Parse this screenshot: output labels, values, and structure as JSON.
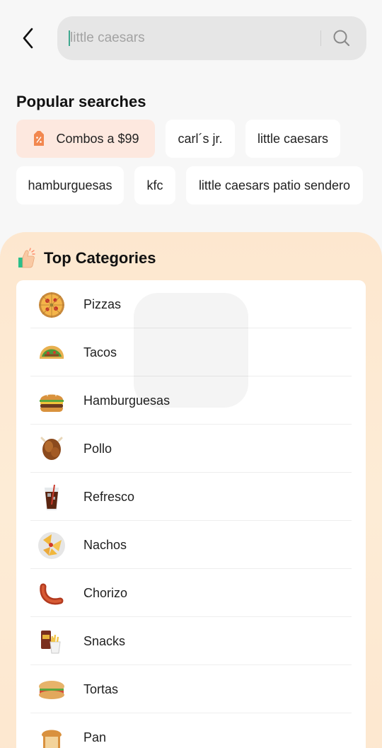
{
  "search": {
    "placeholder": "little caesars",
    "value": ""
  },
  "popular": {
    "title": "Popular searches",
    "chips": [
      {
        "label": "Combos a $99",
        "promo": true
      },
      {
        "label": "carl´s jr."
      },
      {
        "label": "little caesars"
      },
      {
        "label": "hamburguesas"
      },
      {
        "label": "kfc"
      },
      {
        "label": "little caesars patio sendero"
      }
    ]
  },
  "categories": {
    "title": "Top Categories",
    "items": [
      {
        "label": "Pizzas",
        "icon": "pizza-icon"
      },
      {
        "label": "Tacos",
        "icon": "taco-icon"
      },
      {
        "label": "Hamburguesas",
        "icon": "burger-icon"
      },
      {
        "label": "Pollo",
        "icon": "chicken-icon"
      },
      {
        "label": "Refresco",
        "icon": "soda-icon"
      },
      {
        "label": "Nachos",
        "icon": "nachos-icon"
      },
      {
        "label": "Chorizo",
        "icon": "sausage-icon"
      },
      {
        "label": "Snacks",
        "icon": "snacks-icon"
      },
      {
        "label": "Tortas",
        "icon": "sandwich-icon"
      },
      {
        "label": "Pan",
        "icon": "bread-icon"
      }
    ]
  },
  "colors": {
    "accent": "#3fa88f",
    "promo_bg": "#fde8df",
    "promo_icon": "#f2874f",
    "panel_bg": "#fde7cf"
  }
}
